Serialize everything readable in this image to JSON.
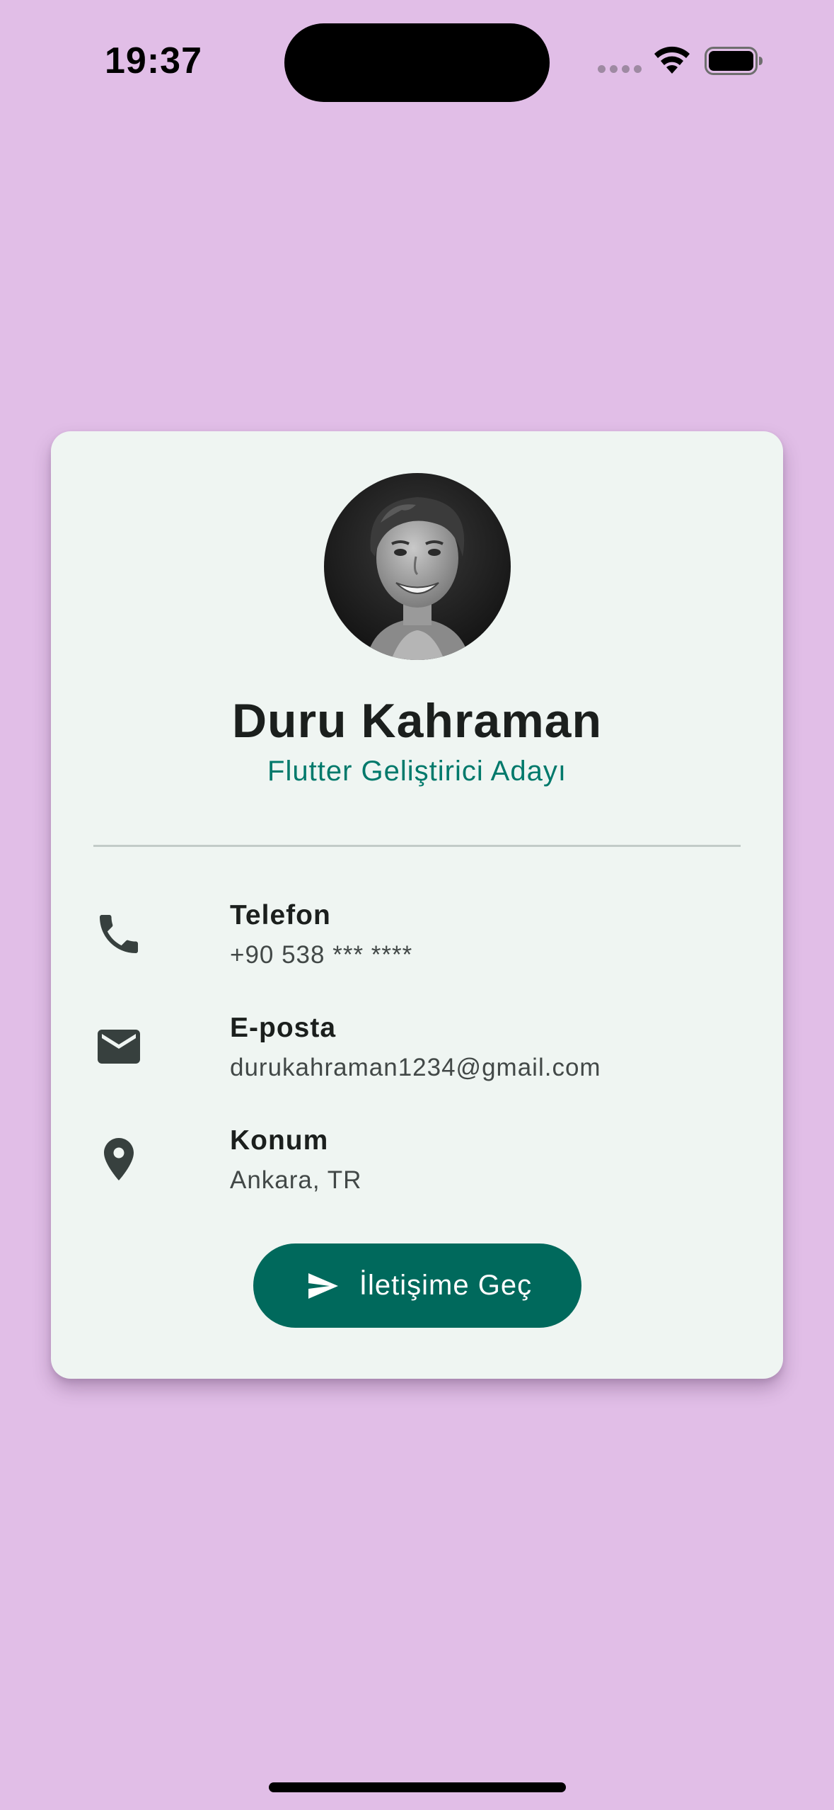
{
  "status_bar": {
    "time": "19:37"
  },
  "profile": {
    "name": "Duru Kahraman",
    "role": "Flutter Geliştirici Adayı",
    "avatar_icon": "profile-photo"
  },
  "contact_items": [
    {
      "label": "Telefon",
      "value": "+90 538 *** ****",
      "icon": "phone-icon"
    },
    {
      "label": "E-posta",
      "value": "durukahraman1234@gmail.com",
      "icon": "email-icon"
    },
    {
      "label": "Konum",
      "value": "Ankara, TR",
      "icon": "location-pin-icon"
    }
  ],
  "action_button": {
    "label": "İletişime Geç",
    "icon": "send-icon"
  },
  "colors": {
    "background": "#E1BEE7",
    "card": "#EFF5F2",
    "accent": "#00796B",
    "button": "#00695C",
    "icon": "#37403E"
  }
}
